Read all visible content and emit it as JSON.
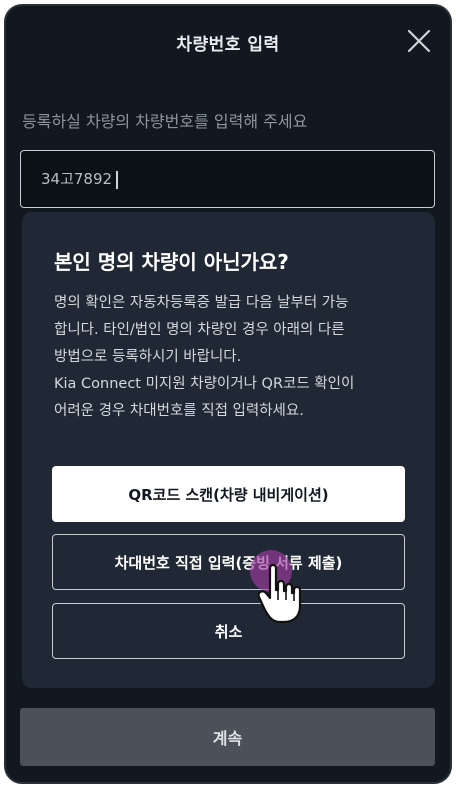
{
  "header": {
    "title": "차량번호 입력"
  },
  "form": {
    "instruction": "등록하실 차량의 차량번호를 입력해 주세요",
    "plate_value": "34고7892"
  },
  "dialog": {
    "title": "본인 명의 차량이 아닌가요?",
    "body_lines": [
      "명의 확인은 자동차등록증 발급 다음 날부터 가능",
      "합니다. 타인/법인 명의 차량인 경우 아래의 다른",
      "방법으로 등록하시기 바랍니다.",
      "Kia Connect 미지원 차량이거나 QR코드 확인이",
      "어려운 경우 차대번호를 직접 입력하세요."
    ],
    "qr_button": "QR코드 스캔(차량 내비게이션)",
    "vin_button": "차대번호 직접 입력(증빙 서류 제출)",
    "cancel_button": "취소"
  },
  "footer": {
    "continue_button": "계속"
  },
  "colors": {
    "background": "#111820",
    "dialog": "#1f2834",
    "footer_button": "#4b5158",
    "tap_highlight": "#a23ca0"
  },
  "icons": [
    "close-icon",
    "hand-cursor-icon"
  ]
}
